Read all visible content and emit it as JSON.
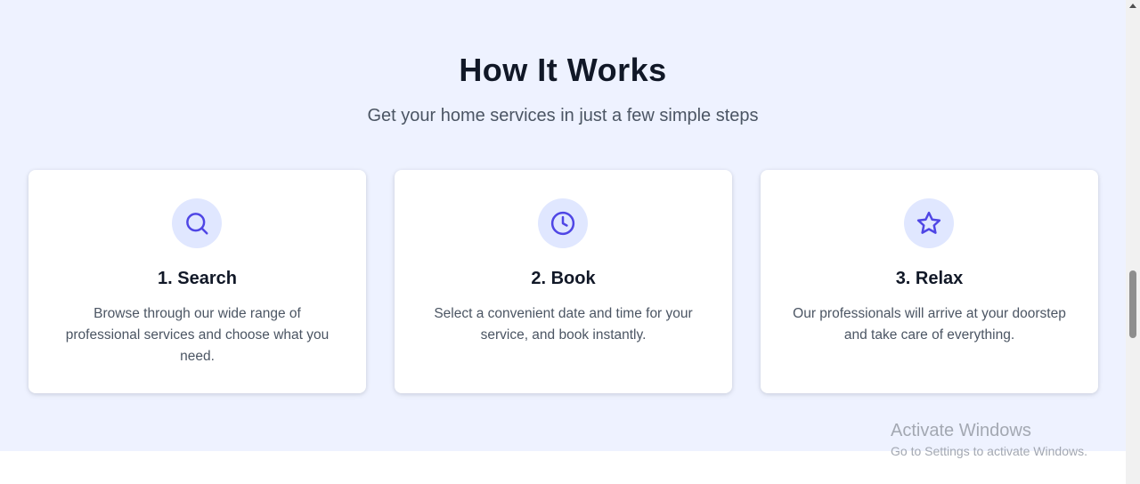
{
  "section": {
    "title": "How It Works",
    "subtitle": "Get your home services in just a few simple steps"
  },
  "steps": [
    {
      "icon": "search-icon",
      "title": "1. Search",
      "description": "Browse through our wide range of professional services and choose what you need."
    },
    {
      "icon": "clock-icon",
      "title": "2. Book",
      "description": "Select a convenient date and time for your service, and book instantly."
    },
    {
      "icon": "star-icon",
      "title": "3. Relax",
      "description": "Our professionals will arrive at your doorstep and take care of everything."
    }
  ],
  "watermark": {
    "title": "Activate Windows",
    "subtitle": "Go to Settings to activate Windows."
  },
  "colors": {
    "section_background": "#eef2ff",
    "icon_background": "#e0e7ff",
    "icon_stroke": "#4f46e5",
    "heading": "#111827",
    "body_text": "#4b5563"
  }
}
